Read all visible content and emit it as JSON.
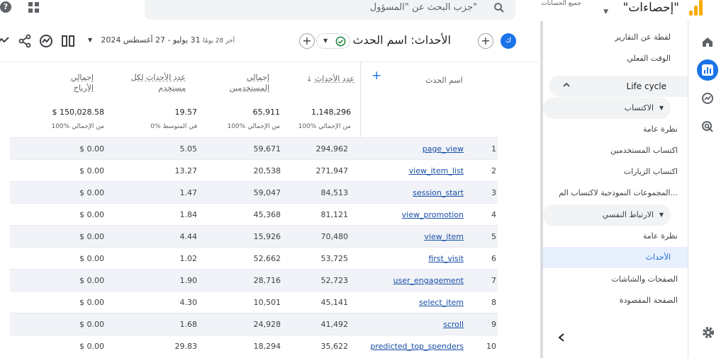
{
  "header": {
    "app_title": "\"إحصاءات\"",
    "account_label": "جميع الحسابات",
    "search_placeholder": "جزب البحث عن \"المسؤول\""
  },
  "toolbar": {
    "avatar_letter": "ك",
    "title": "الأحداث: اسم الحدث",
    "date_prefix": "آخر 28 يومًا",
    "date_range": "31 يوليو - 27 أغسطس 2024"
  },
  "nav": {
    "items": [
      {
        "label": "لقطة عن التقارير",
        "kind": "sec"
      },
      {
        "label": "الوقت الفعلي",
        "kind": "sec"
      },
      {
        "label": "Life cycle",
        "kind": "hdr"
      },
      {
        "label": "الاكتساب",
        "kind": "expander"
      },
      {
        "label": "نظرة عامة",
        "kind": "sub"
      },
      {
        "label": "اكتساب المستخدمين",
        "kind": "sub"
      },
      {
        "label": "اكتساب الزيارات",
        "kind": "sub"
      },
      {
        "label": "المجموعات النموذجية لاكتساب الم...",
        "kind": "sub"
      },
      {
        "label": "الارتباط النفسي",
        "kind": "expander"
      },
      {
        "label": "نظرة عامة",
        "kind": "sub"
      },
      {
        "label": "الأحداث",
        "kind": "active"
      },
      {
        "label": "الصفحات والشاشات",
        "kind": "sub"
      },
      {
        "label": "الصفحة المقصودة",
        "kind": "sub"
      }
    ]
  },
  "table": {
    "col_event": "اسم الحدث",
    "col_count": "عدد الأحداث",
    "col_users_1": "إجمالي",
    "col_users_2": "المستخدمين",
    "col_per_1": "عدد الأحداث لكل",
    "col_per_2": "مستخدم",
    "col_rev_1": "إجمالي",
    "col_rev_2": "الأرباح",
    "totals": {
      "count": "1,148,296",
      "count_sub": "100% من الإجمالي",
      "users": "65,911",
      "users_sub": "100% من الإجمالي",
      "per": "19.57",
      "per_sub": "0% في المتوسط",
      "rev": "$ 150,028.58",
      "rev_sub": "100% من الإجمالي"
    },
    "rows": [
      {
        "i": "1",
        "name": "page_view",
        "count": "294,962",
        "users": "59,671",
        "per": "5.05",
        "rev": "$ 0.00"
      },
      {
        "i": "2",
        "name": "view_item_list",
        "count": "271,947",
        "users": "20,538",
        "per": "13.27",
        "rev": "$ 0.00"
      },
      {
        "i": "3",
        "name": "session_start",
        "count": "84,513",
        "users": "59,047",
        "per": "1.47",
        "rev": "$ 0.00"
      },
      {
        "i": "4",
        "name": "view_promotion",
        "count": "81,121",
        "users": "45,368",
        "per": "1.84",
        "rev": "$ 0.00"
      },
      {
        "i": "5",
        "name": "view_item",
        "count": "70,480",
        "users": "15,926",
        "per": "4.44",
        "rev": "$ 0.00"
      },
      {
        "i": "6",
        "name": "first_visit",
        "count": "53,725",
        "users": "52,662",
        "per": "1.02",
        "rev": "$ 0.00"
      },
      {
        "i": "7",
        "name": "user_engagement",
        "count": "52,723",
        "users": "28,716",
        "per": "1.90",
        "rev": "$ 0.00"
      },
      {
        "i": "8",
        "name": "select_item",
        "count": "45,141",
        "users": "10,501",
        "per": "4.30",
        "rev": "$ 0.00"
      },
      {
        "i": "9",
        "name": "scroll",
        "count": "41,492",
        "users": "24,928",
        "per": "1.68",
        "rev": "$ 0.00"
      },
      {
        "i": "10",
        "name": "predicted_top_spenders",
        "count": "35,622",
        "users": "18,294",
        "per": "29.83",
        "rev": "$ 0.00"
      }
    ]
  },
  "colors": {
    "accent": "#1a73e8",
    "logo": "#f9ab00"
  }
}
